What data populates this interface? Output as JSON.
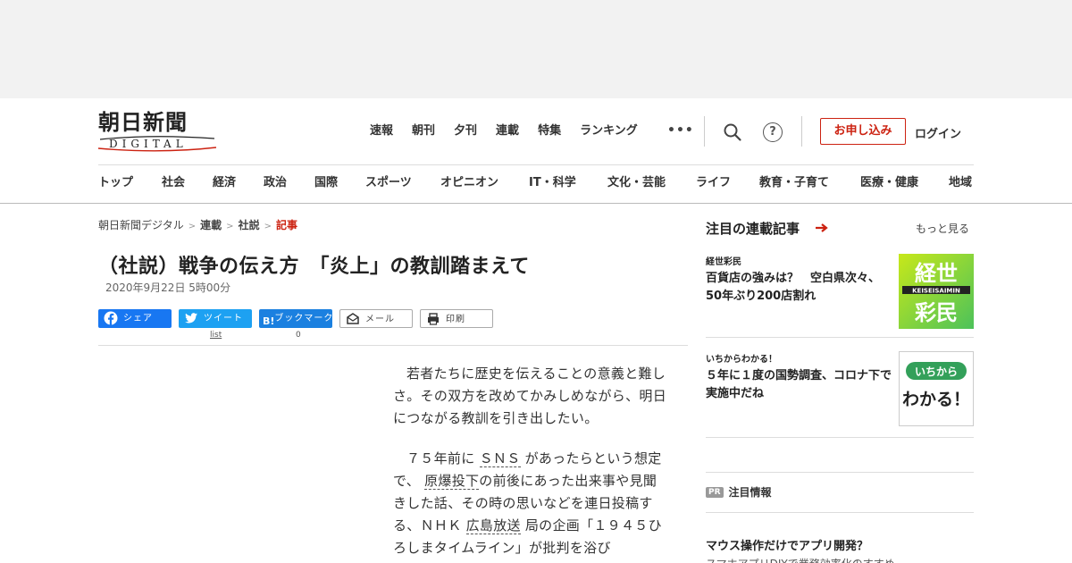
{
  "header": {
    "logo_text": "朝日新聞",
    "logo_sub": "DIGITAL",
    "top_nav": [
      "速報",
      "朝刊",
      "夕刊",
      "連載",
      "特集",
      "ランキング"
    ],
    "more_label": "•••",
    "help_label": "?",
    "apply_label": "お申し込み",
    "login_label": "ログイン",
    "categories": [
      "トップ",
      "社会",
      "経済",
      "政治",
      "国際",
      "スポーツ",
      "オピニオン",
      "IT・科学",
      "文化・芸能",
      "ライフ",
      "教育・子育て",
      "医療・健康",
      "地域"
    ]
  },
  "breadcrumb": [
    "朝日新聞デジタル",
    "連載",
    "社説",
    "記事"
  ],
  "breadcrumb_sep": ">",
  "article": {
    "title": "（社説）戦争の伝え方　「炎上」の教訓踏まえて",
    "date": "2020年9月22日 5時00分",
    "share": {
      "facebook": "シェア",
      "twitter": "ツイート",
      "twitter_count": "list",
      "hatena_icon": "B!",
      "hatena": "ブックマーク",
      "hatena_count": "0",
      "mail": "メール",
      "print": "印刷"
    },
    "p1": "若者たちに歴史を伝えることの意義と難しさ。その双方を改めてかみしめながら、明日につながる教訓を引き出したい。",
    "p2_a": "７５年前に",
    "p2_link1": "ＳＮＳ",
    "p2_b": "があったらという想定で、",
    "p2_link2": "原爆投下",
    "p2_c": "の前後にあった出来事や見聞きした話、その時の思いなどを連日投稿する、ＮＨＫ",
    "p2_link3": "広島放送",
    "p2_d": "局の企画「１９４５ひろしまタイムライン」が批判を浴び"
  },
  "sidebar": {
    "heading": "注目の連載記事",
    "more": "もっと見る",
    "cards": [
      {
        "tag": "経世彩民",
        "headline": "百貨店の強みは？　空白県次々、50年ぶり200店割れ",
        "thumb_top": "経世",
        "thumb_mid": "KEISEISAIMIN",
        "thumb_bottom": "彩民"
      },
      {
        "tag": "いちからわかる！",
        "headline": "５年に１度の国勢調査、コロナ下で実施中だね",
        "thumb_top": "いちから",
        "thumb_bottom": "わかる！"
      }
    ],
    "pr_badge": "PR",
    "pr_label": "注目情報",
    "pr_item": "マウス操作だけでアプリ開発？",
    "pr_sub": "スマホアプリDIYで業務効率化のすすめ"
  },
  "colors": {
    "brand_red": "#cc2211",
    "facebook": "#1877f2",
    "twitter": "#1da1f2",
    "hatena": "#1b80e0"
  }
}
